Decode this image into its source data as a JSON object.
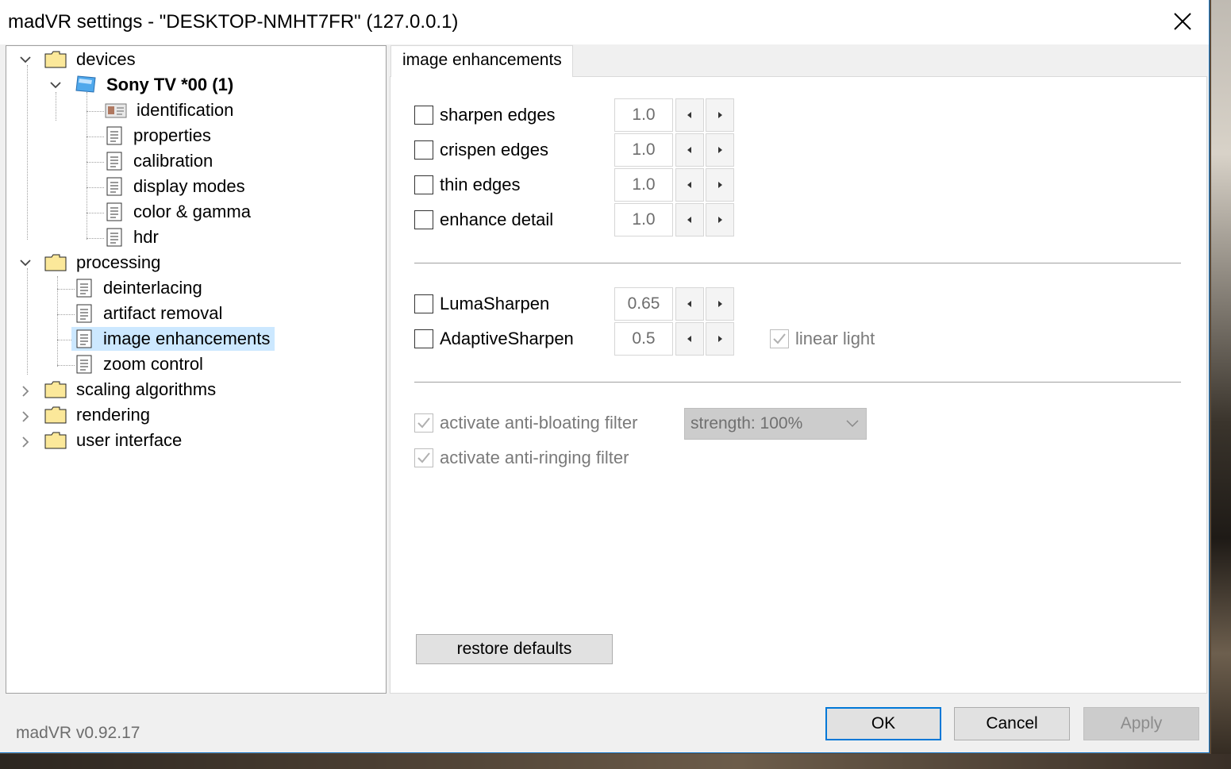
{
  "window": {
    "title": "madVR settings - \"DESKTOP-NMHT7FR\" (127.0.0.1)",
    "accent_color": "#0078d7"
  },
  "tree": {
    "devices": "devices",
    "device_name": "Sony TV *00 (1)",
    "device_items": [
      "identification",
      "properties",
      "calibration",
      "display modes",
      "color & gamma",
      "hdr"
    ],
    "processing": "processing",
    "processing_items": [
      "deinterlacing",
      "artifact removal",
      "image enhancements",
      "zoom control"
    ],
    "selected": "image enhancements",
    "scaling": "scaling algorithms",
    "rendering": "rendering",
    "user_interface": "user interface"
  },
  "tab": {
    "label": "image enhancements"
  },
  "settings": {
    "rows": [
      {
        "label": "sharpen edges",
        "value": "1.0",
        "checked": false
      },
      {
        "label": "crispen edges",
        "value": "1.0",
        "checked": false
      },
      {
        "label": "thin edges",
        "value": "1.0",
        "checked": false
      },
      {
        "label": "enhance detail",
        "value": "1.0",
        "checked": false
      }
    ],
    "luma": {
      "label": "LumaSharpen",
      "value": "0.65",
      "checked": false
    },
    "adaptive": {
      "label": "AdaptiveSharpen",
      "value": "0.5",
      "checked": false
    },
    "linear_light": {
      "label": "linear light",
      "checked": true,
      "disabled": true
    },
    "anti_bloating": {
      "label": "activate anti-bloating filter",
      "checked": true,
      "disabled": true
    },
    "anti_ringing": {
      "label": "activate anti-ringing filter",
      "checked": true,
      "disabled": true
    },
    "strength": "strength: 100%"
  },
  "buttons": {
    "restore": "restore defaults",
    "ok": "OK",
    "cancel": "Cancel",
    "apply": "Apply"
  },
  "version": "madVR v0.92.17"
}
